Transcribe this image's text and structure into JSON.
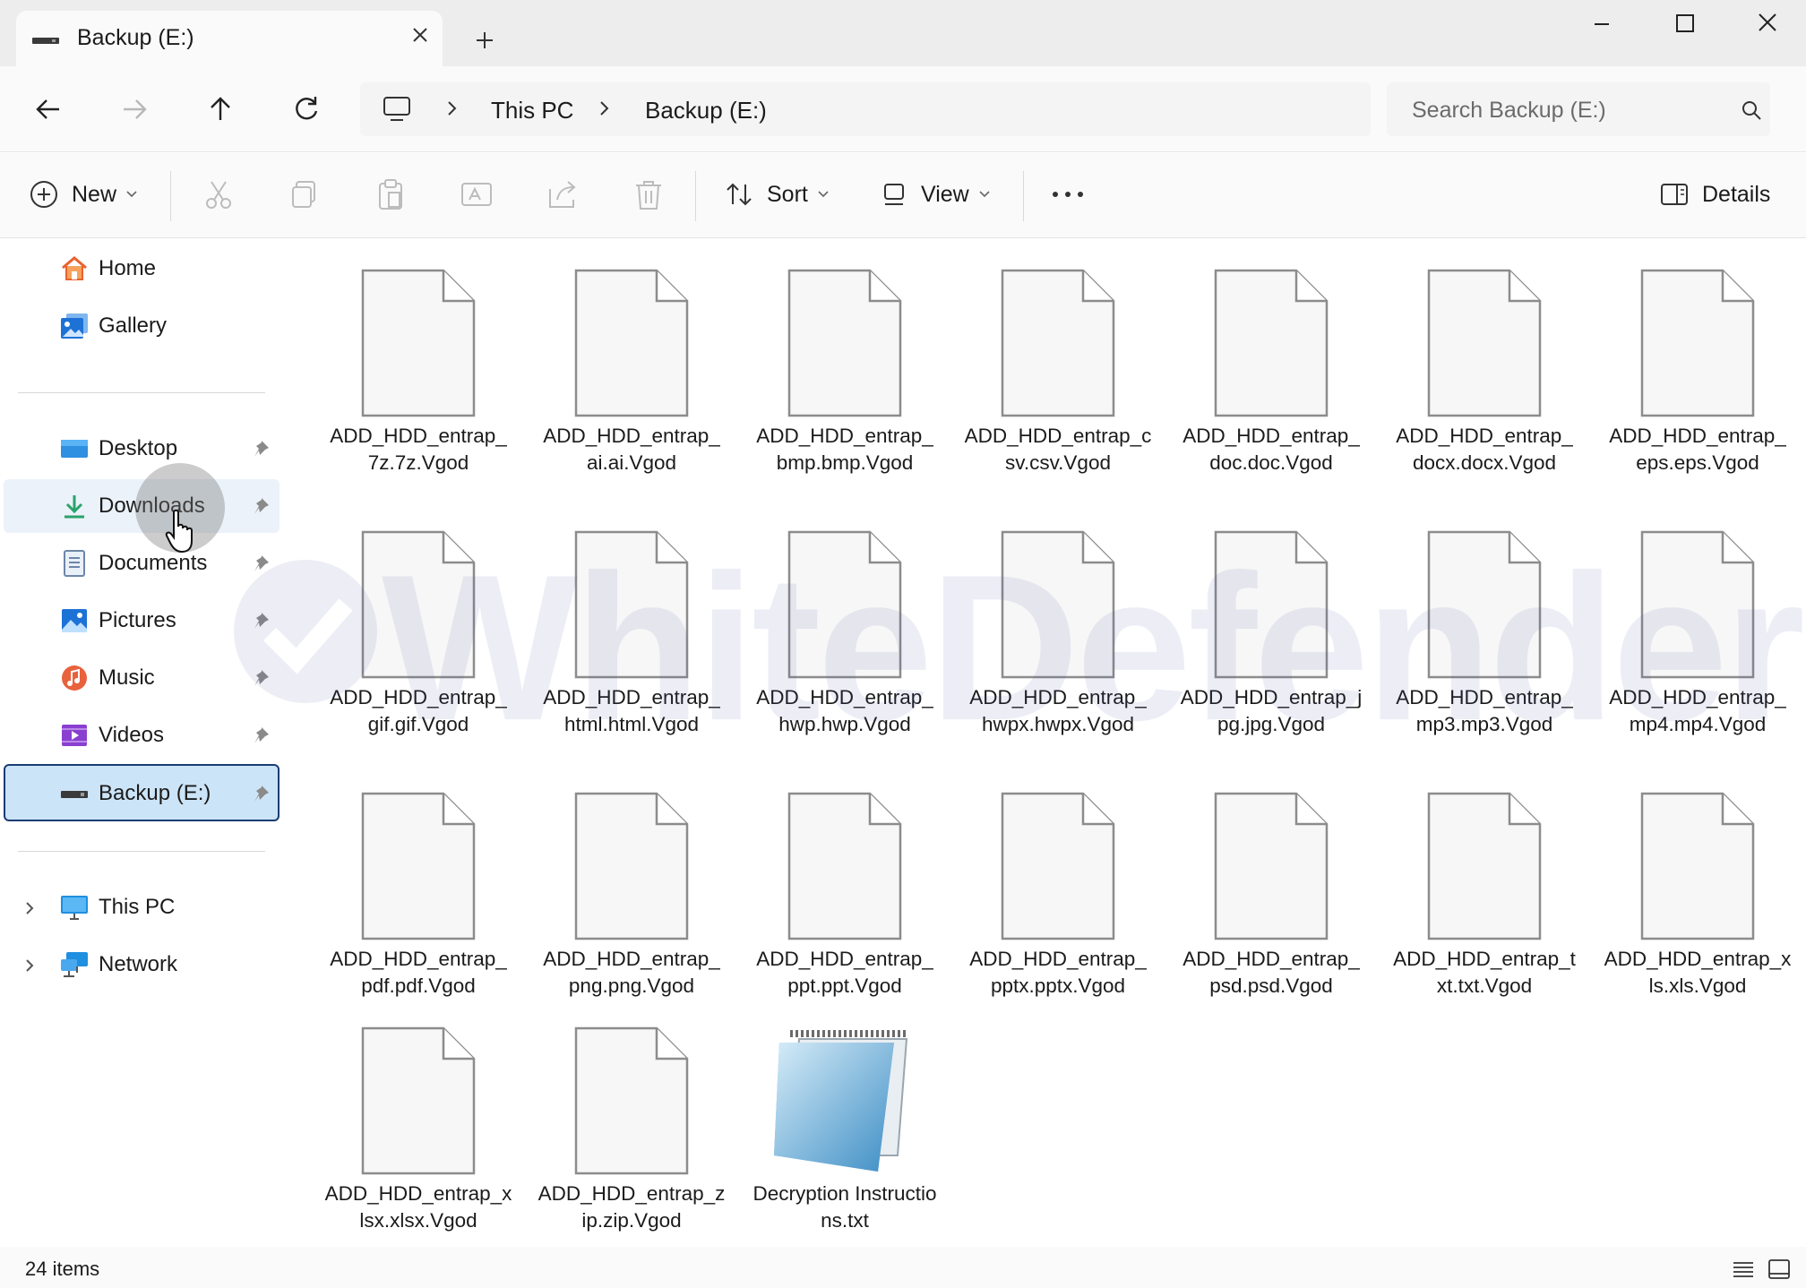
{
  "window": {
    "tab_title": "Backup (E:)"
  },
  "address": {
    "crumbs": [
      "This PC",
      "Backup (E:)"
    ],
    "search_placeholder": "Search Backup (E:)"
  },
  "commands": {
    "new_label": "New",
    "sort_label": "Sort",
    "view_label": "View",
    "more_label": "...",
    "details_label": "Details"
  },
  "sidebar": {
    "items": [
      {
        "label": "Home",
        "icon": "home-icon"
      },
      {
        "label": "Gallery",
        "icon": "gallery-icon"
      },
      {
        "label": "Desktop",
        "icon": "desktop-icon",
        "pinned": true
      },
      {
        "label": "Downloads",
        "icon": "downloads-icon",
        "pinned": true
      },
      {
        "label": "Documents",
        "icon": "documents-icon",
        "pinned": true
      },
      {
        "label": "Pictures",
        "icon": "pictures-icon",
        "pinned": true
      },
      {
        "label": "Music",
        "icon": "music-icon",
        "pinned": true
      },
      {
        "label": "Videos",
        "icon": "videos-icon",
        "pinned": true
      },
      {
        "label": "Backup (E:)",
        "icon": "drive-icon",
        "pinned": true,
        "selected": true
      },
      {
        "label": "This PC",
        "icon": "this-pc-icon"
      },
      {
        "label": "Network",
        "icon": "network-icon"
      }
    ]
  },
  "files": [
    "ADD_HDD_entrap_7z.7z.Vgod",
    "ADD_HDD_entrap_ai.ai.Vgod",
    "ADD_HDD_entrap_bmp.bmp.Vgod",
    "ADD_HDD_entrap_csv.csv.Vgod",
    "ADD_HDD_entrap_doc.doc.Vgod",
    "ADD_HDD_entrap_docx.docx.Vgod",
    "ADD_HDD_entrap_eps.eps.Vgod",
    "ADD_HDD_entrap_gif.gif.Vgod",
    "ADD_HDD_entrap_html.html.Vgod",
    "ADD_HDD_entrap_hwp.hwp.Vgod",
    "ADD_HDD_entrap_hwpx.hwpx.Vgod",
    "ADD_HDD_entrap_jpg.jpg.Vgod",
    "ADD_HDD_entrap_mp3.mp3.Vgod",
    "ADD_HDD_entrap_mp4.mp4.Vgod",
    "ADD_HDD_entrap_pdf.pdf.Vgod",
    "ADD_HDD_entrap_png.png.Vgod",
    "ADD_HDD_entrap_ppt.ppt.Vgod",
    "ADD_HDD_entrap_pptx.pptx.Vgod",
    "ADD_HDD_entrap_psd.psd.Vgod",
    "ADD_HDD_entrap_txt.txt.Vgod",
    "ADD_HDD_entrap_xls.xls.Vgod",
    "ADD_HDD_entrap_xlsx.xlsx.Vgod",
    "ADD_HDD_entrap_zip.zip.Vgod",
    "Decryption Instructions.txt"
  ],
  "status": {
    "item_count": "24 items"
  },
  "watermark": {
    "text": "WhiteDefender"
  },
  "colors": {
    "selection": "#cce4f7",
    "selection_border": "#1a3c74",
    "hover": "#ebf2fa"
  }
}
